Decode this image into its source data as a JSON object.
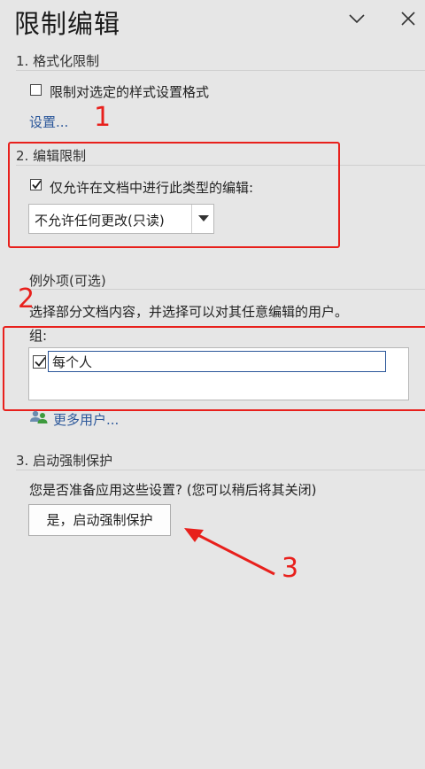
{
  "pane": {
    "title": "限制编辑"
  },
  "section1": {
    "title": "1. 格式化限制",
    "checkbox_label": "限制对选定的样式设置格式",
    "checkbox_checked": false,
    "settings_link": "设置..."
  },
  "section2": {
    "title": "2. 编辑限制",
    "checkbox_label": "仅允许在文档中进行此类型的编辑:",
    "checkbox_checked": true,
    "dropdown_value": "不允许任何更改(只读)"
  },
  "exceptions": {
    "title": "例外项(可选)",
    "description": "选择部分文档内容，并选择可以对其任意编辑的用户。",
    "group_label": "组:",
    "group_items": [
      {
        "label": "每个人",
        "checked": true
      }
    ],
    "more_users_link": "更多用户..."
  },
  "section3": {
    "title": "3. 启动强制保护",
    "question": "您是否准备应用这些设置? (您可以稍后将其关闭)",
    "button_label": "是，启动强制保护"
  },
  "annotations": {
    "note1": "1",
    "note2": "2",
    "note3": "3",
    "color": "#e8201c"
  },
  "icons": {
    "collapse": "chevron-down-icon",
    "close": "close-icon",
    "users": "users-icon",
    "dropdown": "caret-down-icon",
    "checkmark": "checkmark-icon"
  }
}
